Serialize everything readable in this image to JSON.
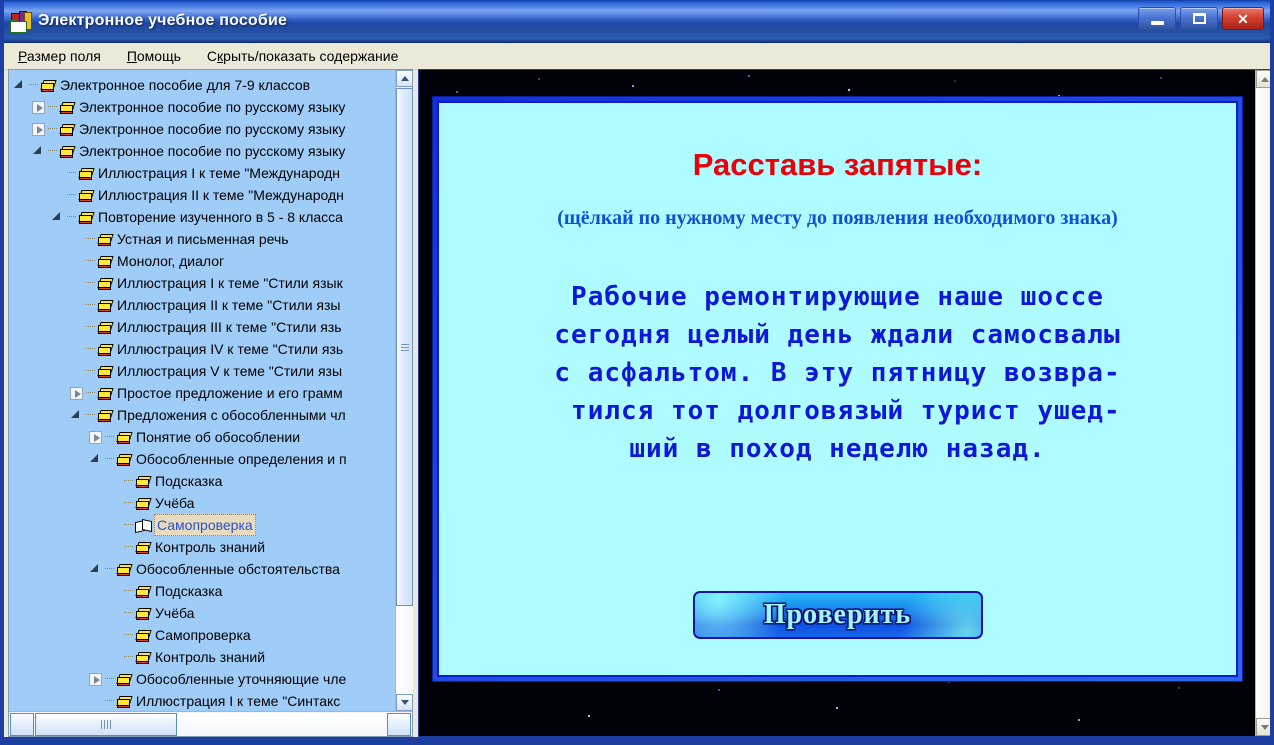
{
  "window": {
    "title": "Электронное учебное пособие",
    "icon": "book-app-icon",
    "buttons": {
      "minimize": "minimize-icon",
      "maximize": "maximize-icon",
      "close": "close-icon"
    }
  },
  "menu": {
    "items": [
      {
        "pre": "",
        "key": "Р",
        "post": "азмер поля"
      },
      {
        "pre": "",
        "key": "П",
        "post": "омощь"
      },
      {
        "pre": "С",
        "key": "к",
        "post": "рыть/показать содержание"
      }
    ]
  },
  "tree": {
    "items": [
      {
        "depth": 0,
        "toggle": "expanded",
        "icon": "book-icon",
        "label": "Электронное пособие для 7-9 классов",
        "selected": false
      },
      {
        "depth": 1,
        "toggle": "collapsed",
        "icon": "book-icon",
        "label": "Электронное пособие по русскому языку",
        "selected": false
      },
      {
        "depth": 1,
        "toggle": "collapsed",
        "icon": "book-icon",
        "label": "Электронное пособие по русскому языку",
        "selected": false
      },
      {
        "depth": 1,
        "toggle": "expanded",
        "icon": "book-icon",
        "label": "Электронное пособие по русскому языку",
        "selected": false
      },
      {
        "depth": 2,
        "toggle": "none",
        "icon": "book-icon",
        "label": "Иллюстрация I к теме \"Международн",
        "selected": false
      },
      {
        "depth": 2,
        "toggle": "none",
        "icon": "book-icon",
        "label": "Иллюстрация II к теме \"Международн",
        "selected": false
      },
      {
        "depth": 2,
        "toggle": "expanded",
        "icon": "book-icon",
        "label": "Повторение изученного в 5 - 8 класса",
        "selected": false
      },
      {
        "depth": 3,
        "toggle": "none",
        "icon": "book-icon",
        "label": "Устная и письменная речь",
        "selected": false
      },
      {
        "depth": 3,
        "toggle": "none",
        "icon": "book-icon",
        "label": "Монолог, диалог",
        "selected": false
      },
      {
        "depth": 3,
        "toggle": "none",
        "icon": "book-icon",
        "label": "Иллюстрация I к теме \"Стили язык",
        "selected": false
      },
      {
        "depth": 3,
        "toggle": "none",
        "icon": "book-icon",
        "label": "Иллюстрация II к теме \"Стили язы",
        "selected": false
      },
      {
        "depth": 3,
        "toggle": "none",
        "icon": "book-icon",
        "label": "Иллюстрация III к теме \"Стили язь",
        "selected": false
      },
      {
        "depth": 3,
        "toggle": "none",
        "icon": "book-icon",
        "label": "Иллюстрация IV к теме \"Стили язь",
        "selected": false
      },
      {
        "depth": 3,
        "toggle": "none",
        "icon": "book-icon",
        "label": "Иллюстрация V к теме \"Стили язы",
        "selected": false
      },
      {
        "depth": 3,
        "toggle": "collapsed",
        "icon": "book-icon",
        "label": "Простое предложение и его грамм",
        "selected": false
      },
      {
        "depth": 3,
        "toggle": "expanded",
        "icon": "book-icon",
        "label": "Предложения с обособленными чл",
        "selected": false
      },
      {
        "depth": 4,
        "toggle": "collapsed",
        "icon": "book-icon",
        "label": "Понятие об обособлении",
        "selected": false
      },
      {
        "depth": 4,
        "toggle": "expanded",
        "icon": "book-icon",
        "label": "Обособленные определения и п",
        "selected": false
      },
      {
        "depth": 5,
        "toggle": "none",
        "icon": "book-icon",
        "label": "Подсказка",
        "selected": false
      },
      {
        "depth": 5,
        "toggle": "none",
        "icon": "book-icon",
        "label": "Учёба",
        "selected": false
      },
      {
        "depth": 5,
        "toggle": "none",
        "icon": "open-book-icon",
        "label": "Самопроверка",
        "selected": true
      },
      {
        "depth": 5,
        "toggle": "none",
        "icon": "book-icon",
        "label": "Контроль знаний",
        "selected": false
      },
      {
        "depth": 4,
        "toggle": "expanded",
        "icon": "book-icon",
        "label": "Обособленные обстоятельства",
        "selected": false
      },
      {
        "depth": 5,
        "toggle": "none",
        "icon": "book-icon",
        "label": "Подсказка",
        "selected": false
      },
      {
        "depth": 5,
        "toggle": "none",
        "icon": "book-icon",
        "label": "Учёба",
        "selected": false
      },
      {
        "depth": 5,
        "toggle": "none",
        "icon": "book-icon",
        "label": "Самопроверка",
        "selected": false
      },
      {
        "depth": 5,
        "toggle": "none",
        "icon": "book-icon",
        "label": "Контроль знаний",
        "selected": false
      },
      {
        "depth": 4,
        "toggle": "collapsed",
        "icon": "book-icon",
        "label": "Обособленные уточняющие чле",
        "selected": false
      },
      {
        "depth": 4,
        "toggle": "none",
        "icon": "book-icon",
        "label": "Иллюстрация I к теме \"Синтакс",
        "selected": false
      }
    ]
  },
  "lesson": {
    "title": "Расставь запятые:",
    "subtitle": "(щёлкай по нужному месту до появления необходимого знака)",
    "exercise_lines": [
      "Рабочие ремонтирующие наше шоссе",
      "сегодня целый день ждали самосвалы",
      "с асфальтом. В эту пятницу возвра-",
      " тился тот долговязый турист ушед-",
      "ший в поход неделю назад."
    ],
    "check_button": "Проверить"
  },
  "colors": {
    "title_red": "#e8000a",
    "subtitle_blue": "#1050d8",
    "exercise_blue": "#1018d8",
    "slide_bg": "#aefcff",
    "tree_bg": "#a0cdf8",
    "selection_bg": "#e8dcc0",
    "selection_text": "#2850d0",
    "button_text": "#9ff6ff"
  }
}
